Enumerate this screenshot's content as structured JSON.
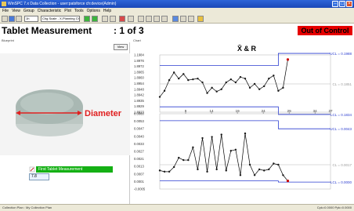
{
  "window": {
    "title": "WinSPC 7.x Data Collection - user:patsforce  ch:device(Admin)"
  },
  "menu": [
    "File",
    "View",
    "Group",
    "Characteristic",
    "Plot",
    "Tools",
    "Options",
    "Help"
  ],
  "toolbar": {
    "zoom": "1h",
    "plot_select": "Chg Scale - X-Planning Cht"
  },
  "header": {
    "title": "Tablet Measurement",
    "page": ": 1 of 3",
    "status": "Out of Control",
    "sub_left": "Blueprint",
    "sub_chart": "Chart"
  },
  "left": {
    "view_button": "View",
    "photo_label": "Diameter",
    "feature_label": "First Tablet Measurement",
    "value": "7.8"
  },
  "chart_data": [
    {
      "type": "line",
      "title": "X̄ & R",
      "x": [
        1,
        2,
        3,
        4,
        5,
        6,
        7,
        8,
        9,
        10,
        11,
        12,
        13,
        14,
        15,
        16,
        17,
        18,
        19,
        20,
        21,
        22,
        23,
        24,
        25,
        26,
        27,
        28
      ],
      "series": [
        {
          "values": [
            1.8943,
            1.8951,
            1.8965,
            1.8975,
            1.8967,
            1.8973,
            1.8965,
            1.8966,
            1.8967,
            1.8962,
            1.8948,
            1.8955,
            1.895,
            1.8953,
            1.8962,
            1.8966,
            1.8962,
            1.8969,
            1.8967,
            1.8955,
            1.896,
            1.8953,
            1.8957,
            1.8967,
            1.8971,
            1.8951,
            1.8955,
            1.8992
          ]
        }
      ],
      "y_ticks": [
        "1.1984",
        "1.8976",
        "1.8972",
        "1.8965",
        "1.8960",
        "1.8954",
        "1.8948",
        "1.8942",
        "1.8935",
        "1.8929",
        "1.8923"
      ],
      "x_ticks": [
        "9",
        "14",
        "19",
        "24",
        "29",
        "34",
        "37"
      ],
      "ucl_label": "UCL = 0.1988",
      "cl_label": "CL = 0.1851",
      "lcl_label": "LCL = 0.1834",
      "colors": {
        "limits": "#2a3cd0",
        "data": "#000000",
        "out": "#cc0000"
      }
    },
    {
      "type": "line",
      "x": [
        1,
        2,
        3,
        4,
        5,
        6,
        7,
        8,
        9,
        10,
        11,
        12,
        13,
        14,
        15,
        16,
        17,
        18,
        19,
        20,
        21,
        22,
        23,
        24,
        25,
        26,
        27,
        28
      ],
      "series": [
        {
          "values": [
            0.0011,
            0.001,
            0.001,
            0.0014,
            0.0022,
            0.002,
            0.002,
            0.0031,
            0.0012,
            0.0039,
            0.001,
            0.004,
            0.0012,
            0.0042,
            0.0011,
            0.0028,
            0.0029,
            0.0007,
            0.0043,
            0.0016,
            0.0007,
            0.0012,
            0.0011,
            0.0012,
            0.0017,
            0.0016,
            0.0007,
            0.0002
          ]
        }
      ],
      "y_ticks": [
        "0.0060",
        "0.0053",
        "0.0047",
        "0.0040",
        "0.0033",
        "0.0027",
        "0.0021",
        "0.0013",
        "0.0007",
        "0.0001",
        "-0.0005"
      ],
      "ucl_label": "UCL = 0.0043",
      "cl_label": "CL = 0.0017",
      "lcl_label": "LCL = 0.0000",
      "colors": {
        "limits": "#2a3cd0",
        "data": "#000000",
        "out": "#cc0000"
      }
    }
  ],
  "statusbar": {
    "left": "Collection Plan : My Collection Plan",
    "right": "Cpk=0.0000  Ppk=0.0000"
  }
}
